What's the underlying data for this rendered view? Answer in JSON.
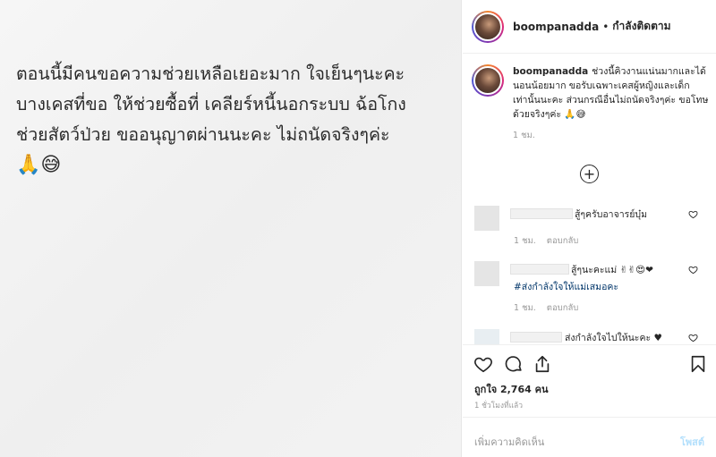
{
  "post": {
    "text": "ตอนนี้มีคนขอความช่วยเหลือเยอะมาก ใจเย็นๆนะคะ\nบางเคสที่ขอ ให้ช่วยซื้อที่ เคลียร์หนี้นอกระบบ ฉ้อโกง\nช่วยสัตว์ป่วย ขออนุญาตผ่านนะคะ ไม่ถนัดจริงๆค่ะ",
    "emoji": "🙏😅"
  },
  "header": {
    "username": "boompanadda",
    "separator": "•",
    "follow_status": "กำลังติดตาม"
  },
  "caption": {
    "username": "boompanadda",
    "text": "ช่วงนี้คิวงานแน่นมากและได้นอนน้อยมาก ขอรับเฉพาะเคสผู้หญิงและเด็กเท่านั้นนะคะ ส่วนกรณีอื่นไม่ถนัดจริงๆค่ะ ขอโทษด้วยจริงๆค่ะ 🙏😅",
    "time": "1 ชม."
  },
  "load_more": "+",
  "comments": [
    {
      "text": "สู้ๆครับอาจารย์บุ๋ม",
      "time": "1 ชม.",
      "reply": "ตอบกลับ"
    },
    {
      "text": "สู้ๆนะคะแม่ ✌✌😍❤",
      "tag": "#ส่งกำลังใจให้แม่เสมอคะ",
      "time": "1 ชม.",
      "reply": "ตอบกลับ"
    },
    {
      "text": "ส่งกำลังใจไปให้นะคะ ♥"
    }
  ],
  "actions": {
    "like": "heart-outline-icon",
    "comment": "comment-bubble-icon",
    "share": "share-upload-icon",
    "save": "bookmark-icon"
  },
  "likes": "ถูกใจ 2,764 คน",
  "time_ago": "1 ชั่วโมงที่แล้ว",
  "add_comment": {
    "placeholder": "เพิ่มความคิดเห็น",
    "post_label": "โพสต์"
  }
}
